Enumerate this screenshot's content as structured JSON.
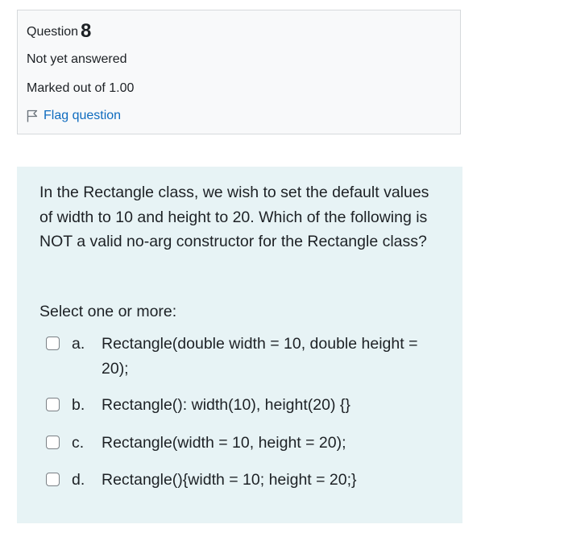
{
  "info": {
    "question_label": "Question",
    "question_number": "8",
    "state": "Not yet answered",
    "grade": "Marked out of 1.00",
    "flag_label": "Flag question"
  },
  "question": {
    "text": "In the Rectangle class, we wish to set the default values of width to 10 and height to 20. Which of the following is NOT a valid no-arg constructor for the Rectangle class?",
    "prompt": "Select one or more:",
    "options": [
      {
        "letter": "a.",
        "text": "Rectangle(double width = 10, double height = 20);",
        "checked": false
      },
      {
        "letter": "b.",
        "text": "Rectangle(): width(10), height(20) {}",
        "checked": false
      },
      {
        "letter": "c.",
        "text": "Rectangle(width = 10, height = 20);",
        "checked": false
      },
      {
        "letter": "d.",
        "text": "Rectangle(){width = 10; height = 20;}",
        "checked": false
      }
    ]
  },
  "colors": {
    "link": "#0f6cbf",
    "info_background": "#f8f9fa",
    "question_background": "#e7f3f5"
  },
  "icons": {
    "flag": "flag-outline-icon"
  }
}
